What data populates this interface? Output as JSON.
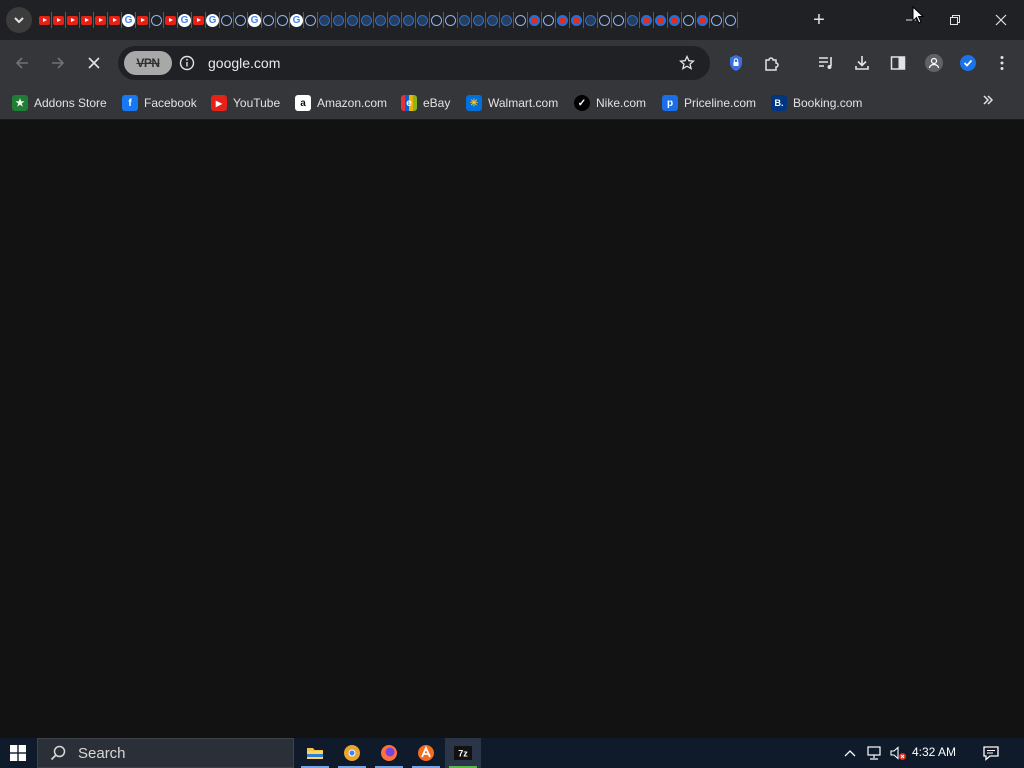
{
  "tabstrip": {
    "tabs": [
      "yt",
      "yt",
      "yt",
      "yt",
      "yt",
      "yt",
      "g",
      "yt",
      "globe",
      "yt",
      "g",
      "yt",
      "g",
      "globe",
      "globe",
      "g",
      "globe",
      "globe",
      "g",
      "globe",
      "globe2",
      "globe2",
      "globe2",
      "globe2",
      "globe2",
      "globe2",
      "globe2",
      "globe2",
      "globe",
      "globe",
      "globe2",
      "globe2",
      "globe2",
      "globe2",
      "globe",
      "red",
      "globe",
      "red",
      "red",
      "globe2",
      "globe",
      "globe",
      "globe2",
      "red",
      "red",
      "red",
      "globe",
      "red",
      "globe",
      "globe"
    ],
    "new_tab_label": "+",
    "window_controls": [
      "minimize-icon",
      "restore-icon",
      "close-icon"
    ]
  },
  "toolbar": {
    "vpn_label": "VPN",
    "url": "google.com",
    "loading": true,
    "extension_icons": [
      "lock-extension-icon",
      "puzzle-icon",
      "media-icon",
      "download-icon",
      "sidebar-icon",
      "profile-icon",
      "shield-check-icon",
      "menu-icon"
    ]
  },
  "bookmarks": [
    {
      "label": "Addons Store",
      "icon_color": "#1e7e34",
      "glyph": "★"
    },
    {
      "label": "Facebook",
      "icon_color": "#1877f2",
      "glyph": "f"
    },
    {
      "label": "YouTube",
      "icon_color": "#e62117",
      "glyph": "▶"
    },
    {
      "label": "Amazon.com",
      "icon_color": "#ffffff",
      "glyph": "a"
    },
    {
      "label": "eBay",
      "icon_color": "#35363a",
      "glyph": "e"
    },
    {
      "label": "Walmart.com",
      "icon_color": "#0071dc",
      "glyph": "✳"
    },
    {
      "label": "Nike.com",
      "icon_color": "#000000",
      "glyph": "✓"
    },
    {
      "label": "Priceline.com",
      "icon_color": "#1a6ee8",
      "glyph": "p"
    },
    {
      "label": "Booking.com",
      "icon_color": "#003580",
      "glyph": "B."
    }
  ],
  "taskbar": {
    "search_placeholder": "Search",
    "apps": [
      "file-explorer-icon",
      "chrome-icon",
      "firefox-icon",
      "avast-icon",
      "7zip-icon"
    ],
    "time": "4:32 AM"
  },
  "colors": {
    "accent": "#8ab4f8",
    "toolbar_bg": "#35363a",
    "tabstrip_bg": "#202124",
    "content_bg": "#121212"
  }
}
